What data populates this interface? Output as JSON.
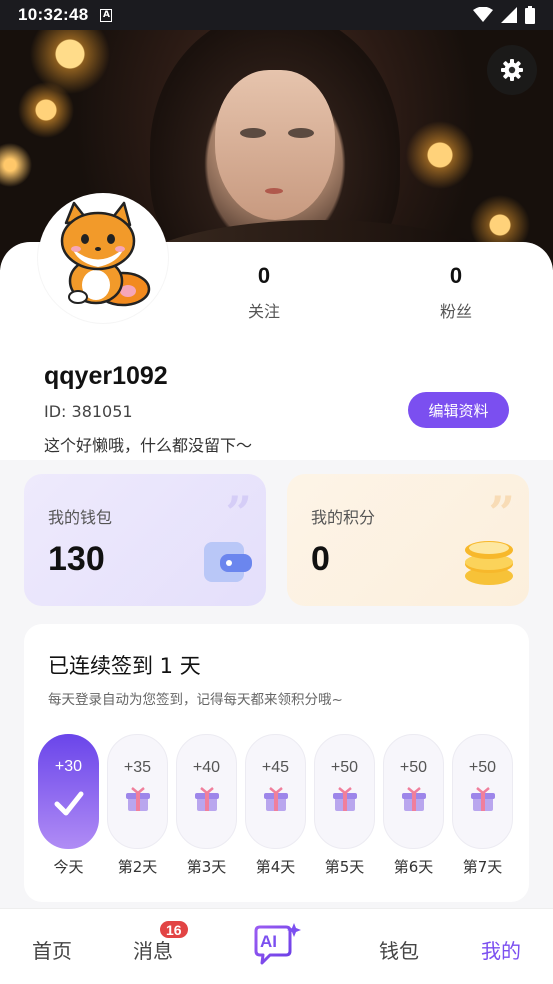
{
  "status_bar": {
    "time": "10:32:48",
    "notification_icon": "A"
  },
  "profile": {
    "following_count": "0",
    "following_label": "关注",
    "fans_count": "0",
    "fans_label": "粉丝",
    "username": "qqyer1092",
    "id_text": "ID: 381051",
    "bio": "这个好懒哦，什么都没留下～",
    "edit_button": "编辑资料"
  },
  "assets": {
    "wallet": {
      "title": "我的钱包",
      "value": "130",
      "icon": "wallet-icon"
    },
    "points": {
      "title": "我的积分",
      "value": "0",
      "icon": "coins-icon"
    }
  },
  "checkin": {
    "title": "已连续签到 1 天",
    "subtitle": "每天登录自动为您签到，记得每天都来领积分哦~",
    "days": [
      {
        "points": "+30",
        "label": "今天",
        "checked": true
      },
      {
        "points": "+35",
        "label": "第2天",
        "checked": false
      },
      {
        "points": "+40",
        "label": "第3天",
        "checked": false
      },
      {
        "points": "+45",
        "label": "第4天",
        "checked": false
      },
      {
        "points": "+50",
        "label": "第5天",
        "checked": false
      },
      {
        "points": "+50",
        "label": "第6天",
        "checked": false
      },
      {
        "points": "+50",
        "label": "第7天",
        "checked": false
      }
    ]
  },
  "tabbar": {
    "home": "首页",
    "messages": "消息",
    "messages_badge": "16",
    "ai": "AI",
    "wallet": "钱包",
    "mine": "我的",
    "active_tab": "我的"
  },
  "colors": {
    "accent": "#7b4ff0",
    "badge": "#e24444",
    "wallet_bg": "#eeeafc",
    "points_bg": "#fdf4e7"
  }
}
